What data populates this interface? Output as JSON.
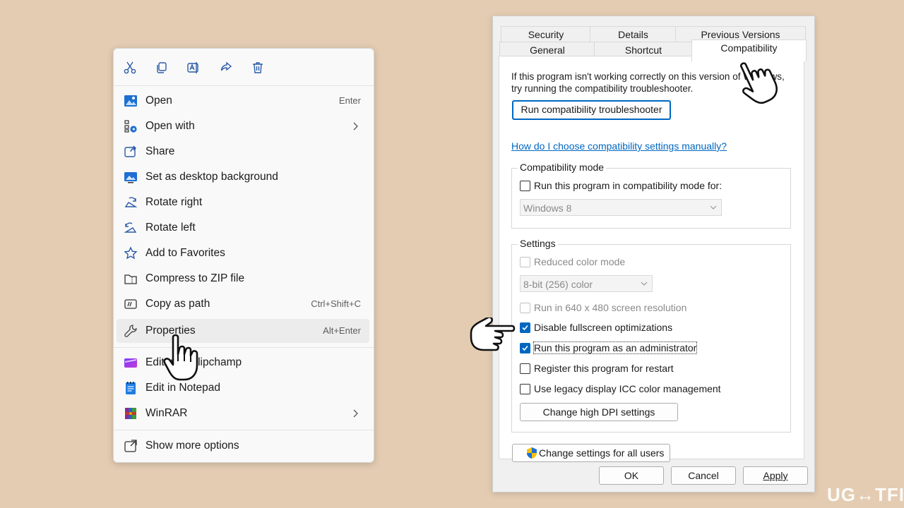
{
  "context_menu": {
    "toolbar": [
      "cut-icon",
      "copy-icon",
      "rename-icon",
      "share-icon",
      "delete-icon"
    ],
    "items": [
      {
        "label": "Open",
        "shortcut": "Enter",
        "icon": "photos-icon"
      },
      {
        "label": "Open with",
        "submenu": true,
        "icon": "open-with-icon"
      },
      {
        "label": "Share",
        "icon": "share-icon"
      },
      {
        "label": "Set as desktop background",
        "icon": "desktop-background-icon"
      },
      {
        "label": "Rotate right",
        "icon": "rotate-right-icon"
      },
      {
        "label": "Rotate left",
        "icon": "rotate-left-icon"
      },
      {
        "label": "Add to Favorites",
        "icon": "star-icon"
      },
      {
        "label": "Compress to ZIP file",
        "icon": "zip-icon"
      },
      {
        "label": "Copy as path",
        "shortcut": "Ctrl+Shift+C",
        "icon": "copy-path-icon"
      },
      {
        "label": "Properties",
        "shortcut": "Alt+Enter",
        "icon": "wrench-icon",
        "highlighted": true
      },
      {
        "label": "Edit with Clipchamp",
        "icon": "clipchamp-icon"
      },
      {
        "label": "Edit in Notepad",
        "icon": "notepad-icon"
      },
      {
        "label": "WinRAR",
        "submenu": true,
        "icon": "winrar-icon"
      },
      {
        "label": "Show more options",
        "icon": "show-more-icon"
      }
    ]
  },
  "dialog": {
    "tabs_row1": [
      "Security",
      "Details",
      "Previous Versions"
    ],
    "tabs_row2": [
      "General",
      "Shortcut",
      "Compatibility"
    ],
    "active_tab": "Compatibility",
    "intro_line1": "If this program isn't working correctly on this version of Windows,",
    "intro_line2": "try running the compatibility troubleshooter.",
    "troubleshooter_button": "Run compatibility troubleshooter",
    "help_link": "How do I choose compatibility settings manually?",
    "compat_mode": {
      "title": "Compatibility mode",
      "checkbox": "Run this program in compatibility mode for:",
      "checked": false,
      "select_value": "Windows 8"
    },
    "settings": {
      "title": "Settings",
      "reduced_color": "Reduced color mode",
      "color_select": "8-bit (256) color",
      "resolution": "Run in 640 x 480 screen resolution",
      "fullscreen": "Disable fullscreen optimizations",
      "fullscreen_checked": true,
      "admin": "Run this program as an administrator",
      "admin_checked": true,
      "restart": "Register this program for restart",
      "restart_checked": false,
      "icc": "Use legacy display ICC color management",
      "icc_checked": false,
      "dpi_button": "Change high DPI settings"
    },
    "all_users_button": "Change settings for all users",
    "ok": "OK",
    "cancel": "Cancel",
    "apply": "Apply"
  },
  "watermark": "UG↔TFIX",
  "colors": {
    "background": "#e4ccb2",
    "accent": "#0067c0"
  }
}
